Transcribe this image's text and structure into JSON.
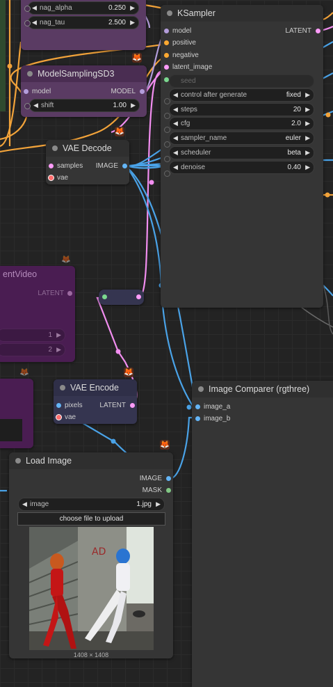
{
  "nag_node": {
    "widgets": [
      {
        "label": "nag_alpha",
        "value": "0.250"
      },
      {
        "label": "nag_tau",
        "value": "2.500"
      }
    ]
  },
  "model_sampling": {
    "title": "ModelSamplingSD3",
    "input_model": "model",
    "output_model": "MODEL",
    "shift_label": "shift",
    "shift_value": "1.00"
  },
  "ksampler": {
    "title": "KSampler",
    "inputs": [
      "model",
      "positive",
      "negative",
      "latent_image"
    ],
    "output": "LATENT",
    "seed_label": "seed",
    "widgets": [
      {
        "label": "control after generate",
        "value": "fixed"
      },
      {
        "label": "steps",
        "value": "20"
      },
      {
        "label": "cfg",
        "value": "2.0"
      },
      {
        "label": "sampler_name",
        "value": "euler"
      },
      {
        "label": "scheduler",
        "value": "beta"
      },
      {
        "label": "denoise",
        "value": "0.40"
      }
    ]
  },
  "vae_decode": {
    "title": "VAE Decode",
    "input_samples": "samples",
    "input_vae": "vae",
    "output": "IMAGE"
  },
  "latent_video": {
    "title_fragment": "entVideo",
    "output": "LATENT",
    "values": [
      "1",
      "2"
    ]
  },
  "vae_encode": {
    "title": "VAE Encode",
    "input_pixels": "pixels",
    "input_vae": "vae",
    "output": "LATENT"
  },
  "image_comparer": {
    "title": "Image Comparer (rgthree)",
    "input_a": "image_a",
    "input_b": "image_b"
  },
  "load_image": {
    "title": "Load Image",
    "output_image": "IMAGE",
    "output_mask": "MASK",
    "image_label": "image",
    "image_value": "1.jpg",
    "upload_label": "choose file to upload",
    "dimensions": "1408 × 1408"
  },
  "colors": {
    "model": "#b39ddb",
    "clip": "#ffd500",
    "conditioning": "#ffa931",
    "latent": "#ff9cf9",
    "image": "#64b5f6",
    "vae": "#ff6e6e",
    "mask": "#81c784"
  },
  "icons": {
    "node_badge": "fox-icon",
    "reroute": "reroute-dot"
  }
}
